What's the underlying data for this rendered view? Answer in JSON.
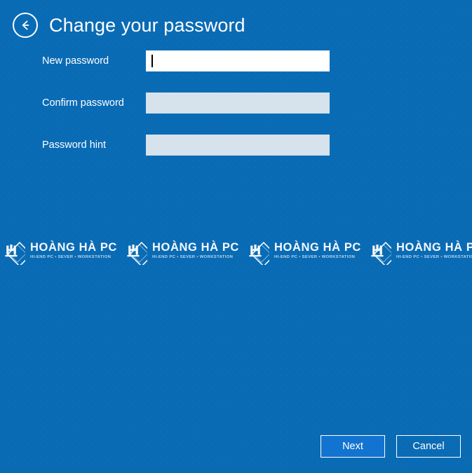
{
  "screen": {
    "title": "Change your password",
    "background_color": "#0a6bb5"
  },
  "header": {
    "back_icon": "back-arrow-circle-icon",
    "title": "Change your password"
  },
  "form": {
    "fields": [
      {
        "label": "New password",
        "value": "",
        "placeholder": "",
        "state": "active",
        "name": "new-password"
      },
      {
        "label": "Confirm password",
        "value": "",
        "placeholder": "",
        "state": "inactive",
        "name": "confirm-password"
      },
      {
        "label": "Password hint",
        "value": "",
        "placeholder": "",
        "state": "inactive",
        "name": "password-hint"
      }
    ]
  },
  "watermark": {
    "name": "HOÀNG HÀ PC",
    "tagline": "HI-END PC • SEVER • WORKSTATION",
    "logo_icon": "diamond-h-monogram-icon",
    "repeat_count": 4
  },
  "footer": {
    "next_label": "Next",
    "cancel_label": "Cancel"
  },
  "colors": {
    "background": "#0a6bb5",
    "active_field": "#ffffff",
    "inactive_field": "#d6e2ec",
    "primary_button": "#1273d0",
    "text": "#ffffff"
  }
}
